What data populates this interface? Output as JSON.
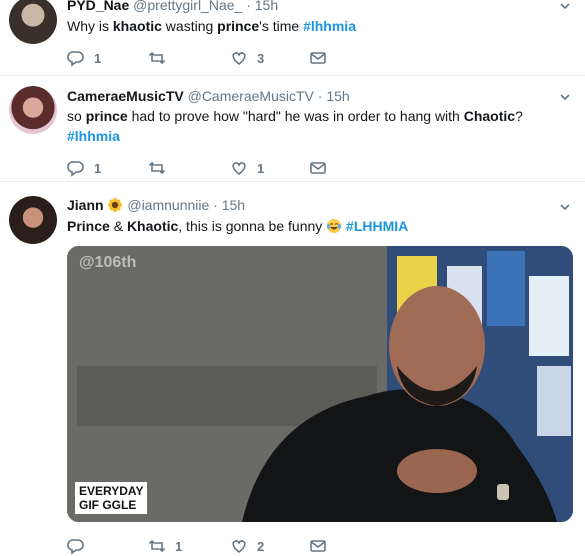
{
  "tweets": [
    {
      "name": "PYD_Nae",
      "handle": "@prettygirl_Nae_",
      "time": "15h",
      "text_parts": [
        "Why is ",
        "khaotic",
        " wasting ",
        "prince",
        "'s time ",
        "#lhhmia"
      ],
      "reply": "1",
      "retweet": "",
      "like": "3"
    },
    {
      "name": "CameraeMusicTV",
      "handle": "@CameraeMusicTV",
      "time": "15h",
      "text_parts": [
        "so ",
        "prince",
        " had to prove how \"hard\" he was in order to hang with ",
        "Chaotic",
        "?"
      ],
      "hashtag": "#lhhmia",
      "reply": "1",
      "retweet": "",
      "like": "1"
    },
    {
      "name": "Jiann",
      "name_emoji": "sunflower",
      "handle": "@iamnunniie",
      "time": "15h",
      "text_parts": [
        "Prince",
        " & ",
        "Khaotic",
        ", this is gonna be funny ",
        "#LHHMIA"
      ],
      "text_emoji": "tears-of-joy",
      "media": {
        "watermark": "@106th",
        "badge_line1": "EVERYDAY",
        "badge_line2": "GIF GGLE"
      },
      "reply": "",
      "retweet": "1",
      "like": "2"
    }
  ],
  "dot": "·",
  "colors": {
    "link": "#1b95e0",
    "muted": "#657786",
    "separator": "#e6ecf0"
  }
}
